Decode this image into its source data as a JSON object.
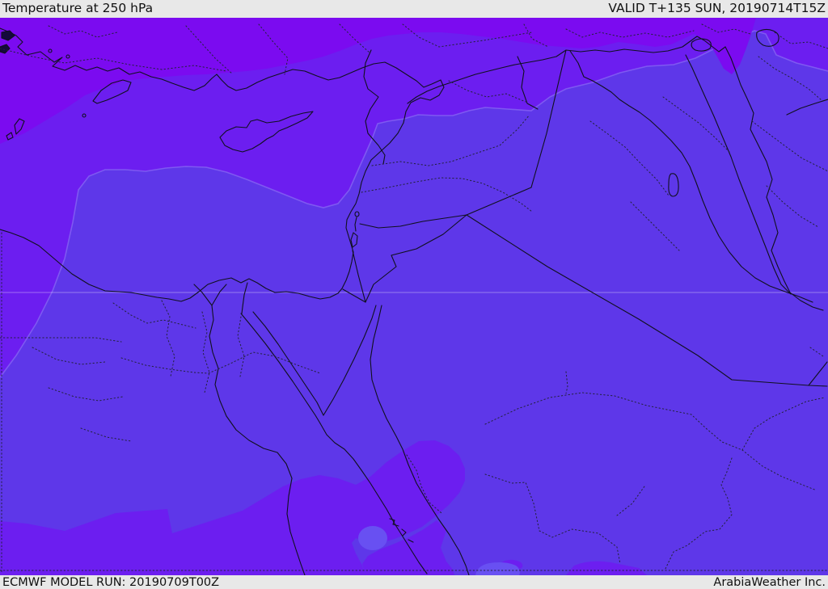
{
  "header": {
    "title": "Temperature at 250 hPa",
    "valid": "VALID T+135 SUN, 20190714T15Z"
  },
  "footer": {
    "model_run": "ECMWF MODEL RUN: 20190709T00Z",
    "brand": "ArabiaWeather Inc."
  },
  "map": {
    "parameter": "Temperature at 250 hPa",
    "model": "ECMWF",
    "region_hint": "Eastern Mediterranean / Middle East",
    "colors": {
      "band_top": "#7b0bf0",
      "band_upper": "#6c1ef0",
      "band_main": "#5e37e9",
      "band_light": "#6850f2",
      "fringe": "#9a86f7",
      "coastline": "#10101e",
      "border_dotted": "#22223a",
      "island_dark": "#15093c",
      "gridline": "rgba(255,255,255,0.35)",
      "bar_bg": "#e8e8e8",
      "bar_text": "#111111"
    }
  }
}
